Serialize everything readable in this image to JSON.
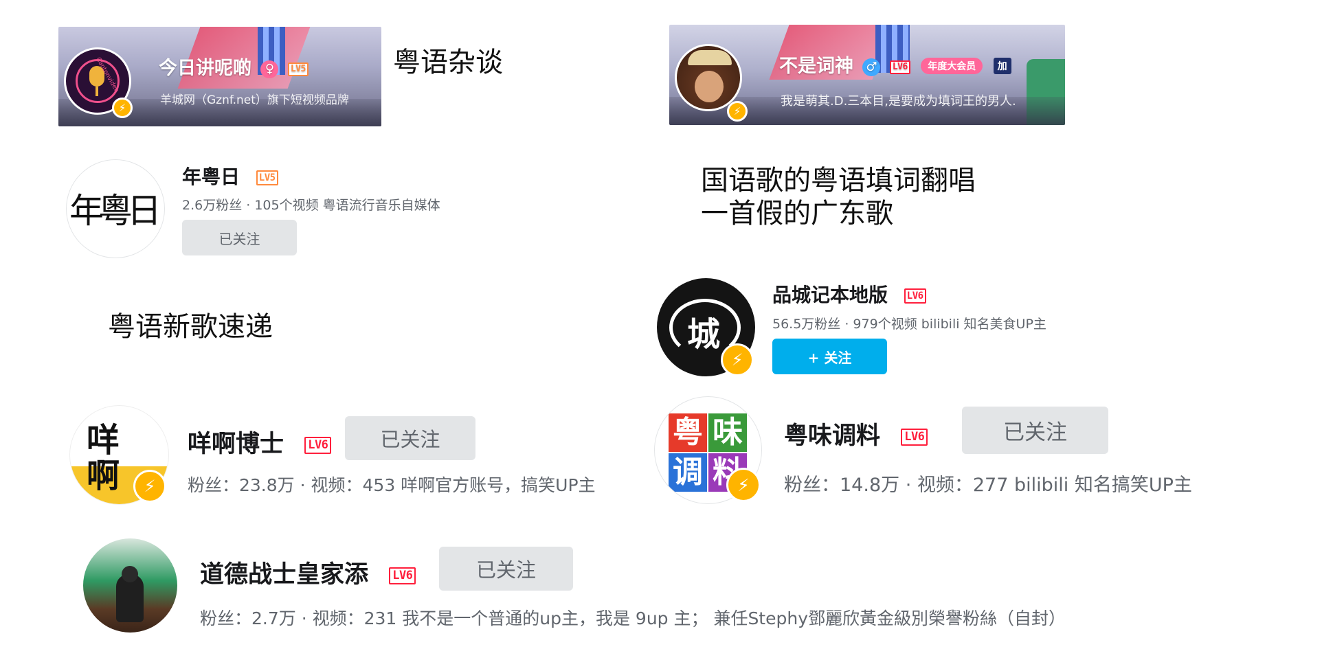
{
  "banners": [
    {
      "name": "今日讲呢啲",
      "gender_symbol": "♀",
      "level": "LV5",
      "signature": "羊城网（Gznf.net）旗下短视频品牌",
      "avatar_text": "Cantonvideo",
      "caption": "粤语杂谈"
    },
    {
      "name": "不是词神",
      "gender_symbol": "♂",
      "level": "LV6",
      "vip_badge": "年度大会员",
      "extra_badge": "加",
      "signature": "我是萌其.D.三本目,是要成为填词王的男人.",
      "caption_lines": [
        "国语歌的粤语填词翻唱",
        "一首假的广东歌"
      ]
    }
  ],
  "cards": {
    "nianyueri": {
      "avatar_text": "年粵日",
      "name": "年粤日",
      "level": "LV5",
      "meta": "2.6万粉丝 · 105个视频  粤语流行音乐自媒体",
      "button": "已关注"
    },
    "pincheng": {
      "avatar_text": "城",
      "name": "品城记本地版",
      "level": "LV6",
      "meta": "56.5万粉丝 · 979个视频  bilibili 知名美食UP主",
      "button": "+ 关注"
    },
    "yeah": {
      "avatar_text": "咩啊",
      "name": "咩啊博士",
      "level": "LV6",
      "meta": "粉丝：23.8万 · 视频：453  咩啊官方账号，搞笑UP主",
      "button": "已关注"
    },
    "yuewei": {
      "avatar_text": [
        "粤",
        "味",
        "调",
        "料"
      ],
      "name": "粤味调料",
      "level": "LV6",
      "meta": "粉丝：14.8万 · 视频：277  bilibili 知名搞笑UP主",
      "button": "已关注"
    },
    "daode": {
      "name": "道德战士皇家添",
      "level": "LV6",
      "meta": "粉丝：2.7万 · 视频：231  我不是一个普通的up主，我是 9up 主；  兼任Stephy鄧麗欣黃金級別榮譽粉絲（自封）",
      "button": "已关注"
    }
  },
  "captions": {
    "new_songs": "粤语新歌速递"
  },
  "icons": {
    "bolt": "⚡"
  },
  "colors": {
    "bilibili_blue": "#00aeec",
    "lv6_red": "#ff1f3c",
    "lv5_orange": "#ff8a3d",
    "bolt_yellow": "#ffb400"
  }
}
